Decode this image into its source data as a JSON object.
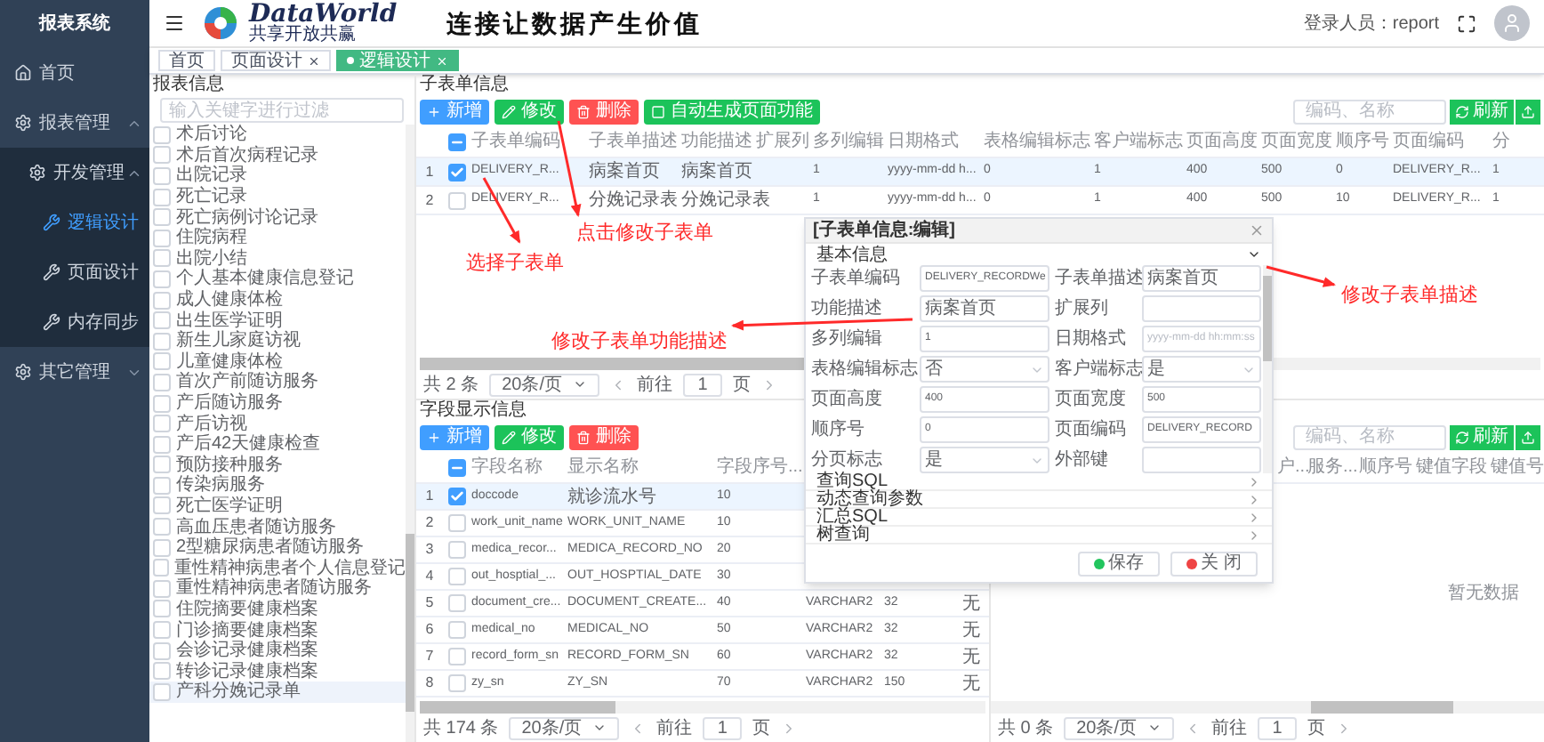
{
  "sidebar": {
    "title": "报表系统",
    "items": [
      {
        "label": "首页",
        "kind": "home"
      },
      {
        "label": "报表管理",
        "kind": "gear",
        "expanded": true,
        "children": [
          {
            "label": "开发管理",
            "kind": "gear",
            "expanded": true,
            "children": [
              {
                "label": "逻辑设计",
                "kind": "tool",
                "selected": true
              },
              {
                "label": "页面设计",
                "kind": "tool",
                "selected": false
              },
              {
                "label": "内存同步",
                "kind": "tool",
                "selected": false
              }
            ]
          }
        ]
      },
      {
        "label": "其它管理",
        "kind": "gear",
        "expanded": false
      }
    ]
  },
  "header": {
    "logo_title": "DataWorld",
    "logo_subtitle": "共享开放共赢",
    "slogan": "连接让数据产生价值",
    "user_label": "登录人员：report"
  },
  "tabs": [
    {
      "label": "首页",
      "closable": false,
      "selected": false
    },
    {
      "label": "页面设计",
      "closable": true,
      "selected": false
    },
    {
      "label": "逻辑设计",
      "closable": true,
      "selected": true
    }
  ],
  "tree": {
    "title": "报表信息",
    "search": {
      "placeholder": "输入关键字进行过滤"
    },
    "items": [
      {
        "label": "术后讨论",
        "checked": false,
        "selected": false
      },
      {
        "label": "术后首次病程记录",
        "checked": false,
        "selected": false
      },
      {
        "label": "出院记录",
        "checked": false,
        "selected": false
      },
      {
        "label": "死亡记录",
        "checked": false,
        "selected": false
      },
      {
        "label": "死亡病例讨论记录",
        "checked": false,
        "selected": false
      },
      {
        "label": "住院病程",
        "checked": false,
        "selected": false
      },
      {
        "label": "出院小结",
        "checked": false,
        "selected": false
      },
      {
        "label": "个人基本健康信息登记",
        "checked": false,
        "selected": false
      },
      {
        "label": "成人健康体检",
        "checked": false,
        "selected": false
      },
      {
        "label": "出生医学证明",
        "checked": false,
        "selected": false
      },
      {
        "label": "新生儿家庭访视",
        "checked": false,
        "selected": false
      },
      {
        "label": "儿童健康体检",
        "checked": false,
        "selected": false
      },
      {
        "label": "首次产前随访服务",
        "checked": false,
        "selected": false
      },
      {
        "label": "产后随访服务",
        "checked": false,
        "selected": false
      },
      {
        "label": "产后访视",
        "checked": false,
        "selected": false
      },
      {
        "label": "产后42天健康检查",
        "checked": false,
        "selected": false
      },
      {
        "label": "预防接种服务",
        "checked": false,
        "selected": false
      },
      {
        "label": "传染病服务",
        "checked": false,
        "selected": false
      },
      {
        "label": "死亡医学证明",
        "checked": false,
        "selected": false
      },
      {
        "label": "高血压患者随访服务",
        "checked": false,
        "selected": false
      },
      {
        "label": "2型糖尿病患者随访服务",
        "checked": false,
        "selected": false
      },
      {
        "label": "重性精神病患者个人信息登记",
        "checked": false,
        "selected": false
      },
      {
        "label": "重性精神病患者随访服务",
        "checked": false,
        "selected": false
      },
      {
        "label": "住院摘要健康档案",
        "checked": false,
        "selected": false
      },
      {
        "label": "门诊摘要健康档案",
        "checked": false,
        "selected": false
      },
      {
        "label": "会诊记录健康档案",
        "checked": false,
        "selected": false
      },
      {
        "label": "转诊记录健康档案",
        "checked": false,
        "selected": false
      },
      {
        "label": "产科分娩记录单",
        "checked": false,
        "selected": true
      }
    ]
  },
  "sub_form": {
    "title": "子表单信息",
    "buttons": [
      {
        "label": "新增",
        "kind": "add"
      },
      {
        "label": "修改",
        "kind": "edit"
      },
      {
        "label": "删除",
        "kind": "delete"
      },
      {
        "label": "自动生成页面功能",
        "kind": "generate"
      }
    ],
    "search": {
      "placeholder": "编码、名称"
    },
    "refresh": "刷新",
    "indeterminate": true,
    "columns": [
      "子表单编码",
      "子表单描述",
      "功能描述",
      "扩展列",
      "多列编辑",
      "日期格式",
      "表格编辑标志",
      "客户端标志",
      "页面高度",
      "页面宽度",
      "顺序号",
      "页面编码",
      "分"
    ],
    "rows": [
      {
        "index": "1",
        "checked": true,
        "selected": true,
        "cells": [
          "DELIVERY_R...",
          "病案首页",
          "病案首页",
          null,
          "1",
          "yyyy-mm-dd h...",
          "0",
          "1",
          "400",
          "500",
          "0",
          "DELIVERY_R...",
          "1"
        ]
      },
      {
        "index": "2",
        "checked": false,
        "selected": false,
        "cells": [
          "DELIVERY_R...",
          "分娩记录表",
          "分娩记录表",
          null,
          "1",
          "yyyy-mm-dd h...",
          "0",
          "1",
          "400",
          "500",
          "10",
          "DELIVERY_R...",
          "1"
        ]
      }
    ],
    "pagination": {
      "total": "共 2 条",
      "page_size": "20条/页",
      "goto": "前往",
      "page": "1",
      "page_unit": "页"
    }
  },
  "fields": {
    "title": "字段显示信息",
    "buttons": [
      {
        "label": "新增",
        "kind": "add"
      },
      {
        "label": "修改",
        "kind": "edit"
      },
      {
        "label": "删除",
        "kind": "delete"
      }
    ],
    "indeterminate": true,
    "columns": [
      "字段名称",
      "显示名称",
      "字段序号..."
    ],
    "rows": [
      {
        "index": "1",
        "checked": true,
        "selected": true,
        "cells": [
          "doccode",
          "就诊流水号",
          "10",
          null,
          null,
          null,
          null
        ]
      },
      {
        "index": "2",
        "checked": false,
        "selected": false,
        "cells": [
          "work_unit_name",
          "WORK_UNIT_NAME",
          "10",
          null,
          null,
          null,
          null
        ]
      },
      {
        "index": "3",
        "checked": false,
        "selected": false,
        "cells": [
          "medica_recor...",
          "MEDICA_RECORD_NO",
          "20",
          null,
          null,
          null,
          null
        ]
      },
      {
        "index": "4",
        "checked": false,
        "selected": false,
        "cells": [
          "out_hosptial_...",
          "OUT_HOSPTIAL_DATE",
          "30",
          null,
          null,
          null,
          null
        ]
      },
      {
        "index": "5",
        "checked": false,
        "selected": false,
        "cells": [
          "document_cre...",
          "DOCUMENT_CREATE...",
          "40",
          "VARCHAR2",
          "32",
          null,
          "无"
        ]
      },
      {
        "index": "6",
        "checked": false,
        "selected": false,
        "cells": [
          "medical_no",
          "MEDICAL_NO",
          "50",
          "VARCHAR2",
          "32",
          null,
          "无"
        ]
      },
      {
        "index": "7",
        "checked": false,
        "selected": false,
        "cells": [
          "record_form_sn",
          "RECORD_FORM_SN",
          "60",
          "VARCHAR2",
          "32",
          null,
          "无"
        ]
      },
      {
        "index": "8",
        "checked": false,
        "selected": false,
        "cells": [
          "zy_sn",
          "ZY_SN",
          "70",
          "VARCHAR2",
          "150",
          null,
          "无"
        ]
      }
    ],
    "pagination": {
      "total": "共 174 条",
      "page_size": "20条/页",
      "goto": "前往",
      "page": "1",
      "page_unit": "页"
    }
  },
  "key_table": {
    "search": {
      "placeholder": "编码、名称"
    },
    "refresh": "刷新",
    "columns": [
      "户...",
      "服务...",
      "顺序号",
      "键值字段",
      "键值号"
    ],
    "empty": "暂无数据",
    "pagination": {
      "total": "共 0 条",
      "page_size": "20条/页",
      "goto": "前往",
      "page": "1",
      "page_unit": "页"
    }
  },
  "dialog": {
    "title": "[子表单信息:编辑]",
    "section": {
      "label": "基本信息",
      "expanded": true
    },
    "fields": [
      {
        "label": "子表单编码",
        "kind": "text",
        "value": "DELIVERY_RECORDWe"
      },
      {
        "label": "子表单描述",
        "kind": "text",
        "value": "病案首页"
      },
      {
        "label": "功能描述",
        "kind": "text",
        "value": "病案首页"
      },
      {
        "label": "扩展列",
        "kind": "text"
      },
      {
        "label": "多列编辑",
        "kind": "text",
        "value": "1"
      },
      {
        "label": "日期格式",
        "kind": "text",
        "placeholder": "yyyy-mm-dd hh:mm:ss"
      },
      {
        "label": "表格编辑标志",
        "kind": "select",
        "value": "否"
      },
      {
        "label": "客户端标志",
        "kind": "select",
        "value": "是"
      },
      {
        "label": "页面高度",
        "kind": "text",
        "value": "400"
      },
      {
        "label": "页面宽度",
        "kind": "text",
        "value": "500"
      },
      {
        "label": "顺序号",
        "kind": "text",
        "value": "0"
      },
      {
        "label": "页面编码",
        "kind": "text",
        "value": "DELIVERY_RECORD"
      },
      {
        "label": "分页标志",
        "kind": "select",
        "value": "是"
      },
      {
        "label": "外部键",
        "kind": "text"
      }
    ],
    "panels": [
      {
        "label": "查询SQL",
        "expanded": false
      },
      {
        "label": "动态查询参数",
        "expanded": false
      },
      {
        "label": "汇总SQL",
        "expanded": false
      },
      {
        "label": "树查询",
        "expanded": false
      }
    ],
    "buttons": [
      {
        "label": "保存",
        "kind": "save"
      },
      {
        "label": "关 闭",
        "kind": "close"
      }
    ]
  },
  "annotations": [
    {
      "text": "选择子表单"
    },
    {
      "text": "点击修改子表单"
    },
    {
      "text": "修改子表单功能描述"
    },
    {
      "text": "修改子表单描述"
    }
  ]
}
